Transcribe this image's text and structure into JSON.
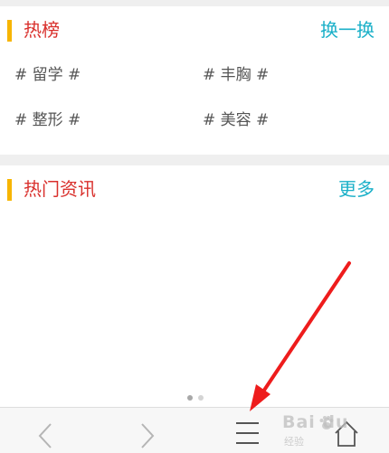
{
  "hot_list": {
    "title": "热榜",
    "action": "换一换",
    "tags": [
      "# 留学 #",
      "# 丰胸 #",
      "# 整形 #",
      "# 美容 #"
    ]
  },
  "hot_news": {
    "title": "热门资讯",
    "action": "更多"
  },
  "pager": {
    "total": 2,
    "active": 1
  },
  "nav": {
    "icons": [
      "back-arrow-icon",
      "forward-arrow-icon",
      "menu-icon",
      "home-icon"
    ]
  },
  "watermark": {
    "brand": "Bai  du",
    "sub": "经验"
  },
  "colors": {
    "accent_bar": "#f7b500",
    "title_red": "#d9302c",
    "link_cyan": "#1bb0c8",
    "annotation_arrow": "#ee1c1c"
  }
}
